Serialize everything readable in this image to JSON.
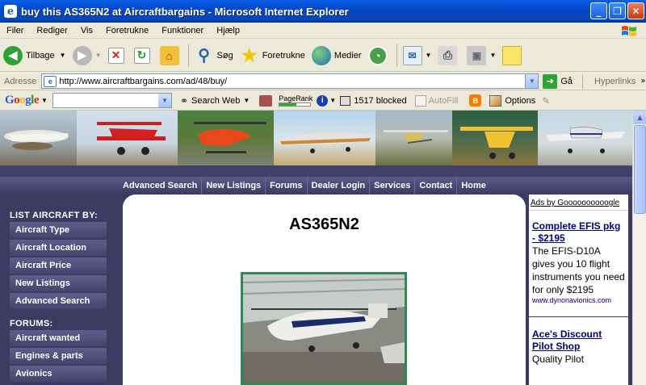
{
  "window": {
    "title": "buy this AS365N2 at Aircraftbargains - Microsoft Internet Explorer",
    "min_glyph": "_",
    "max_glyph": "❐",
    "close_glyph": "✕"
  },
  "menu": [
    "Filer",
    "Rediger",
    "Vis",
    "Foretrukne",
    "Funktioner",
    "Hjælp"
  ],
  "toolbar": {
    "back": "Tilbage",
    "search": "Søg",
    "favorites": "Foretrukne",
    "media": "Medier"
  },
  "address": {
    "label": "Adresse",
    "url": "http://www.aircraftbargains.com/ad/48/buy/",
    "go": "Gå",
    "links": "Hyperlinks"
  },
  "google": {
    "logo": "Google",
    "search_web": "Search Web",
    "pagerank": "PageRank",
    "pagerank_level": 0.55,
    "blocked": "1517 blocked",
    "autofill": "AutoFill",
    "options": "Options"
  },
  "site": {
    "nav": [
      "Advanced Search",
      "New Listings",
      "Forums",
      "Dealer Login",
      "Services",
      "Contact",
      "Home"
    ],
    "list_heading": "LIST AIRCRAFT BY:",
    "list_items": [
      "Aircraft Type",
      "Aircraft Location",
      "Aircraft Price",
      "New Listings",
      "Advanced Search"
    ],
    "forums_heading": "FORUMS:",
    "forum_items": [
      "Aircraft wanted",
      "Engines & parts",
      "Avionics"
    ],
    "title": "AS365N2",
    "ads_label": "Ads by Goooooooooogle",
    "ads": [
      {
        "title": "Complete EFIS pkg - $2195",
        "body": "The EFIS-D10A gives you 10 flight instruments you need for only $2195",
        "url": "www.dynonavionics.com"
      },
      {
        "title": "Ace's Discount Pilot Shop",
        "body": "Quality Pilot",
        "url": ""
      }
    ]
  },
  "colors": {
    "xp_blue": "#0448c8",
    "site_bg": "#3a3a5e",
    "nav_bg": "#4a4a7a",
    "photo_border": "#2e8a52",
    "ad_link": "#00007a"
  }
}
